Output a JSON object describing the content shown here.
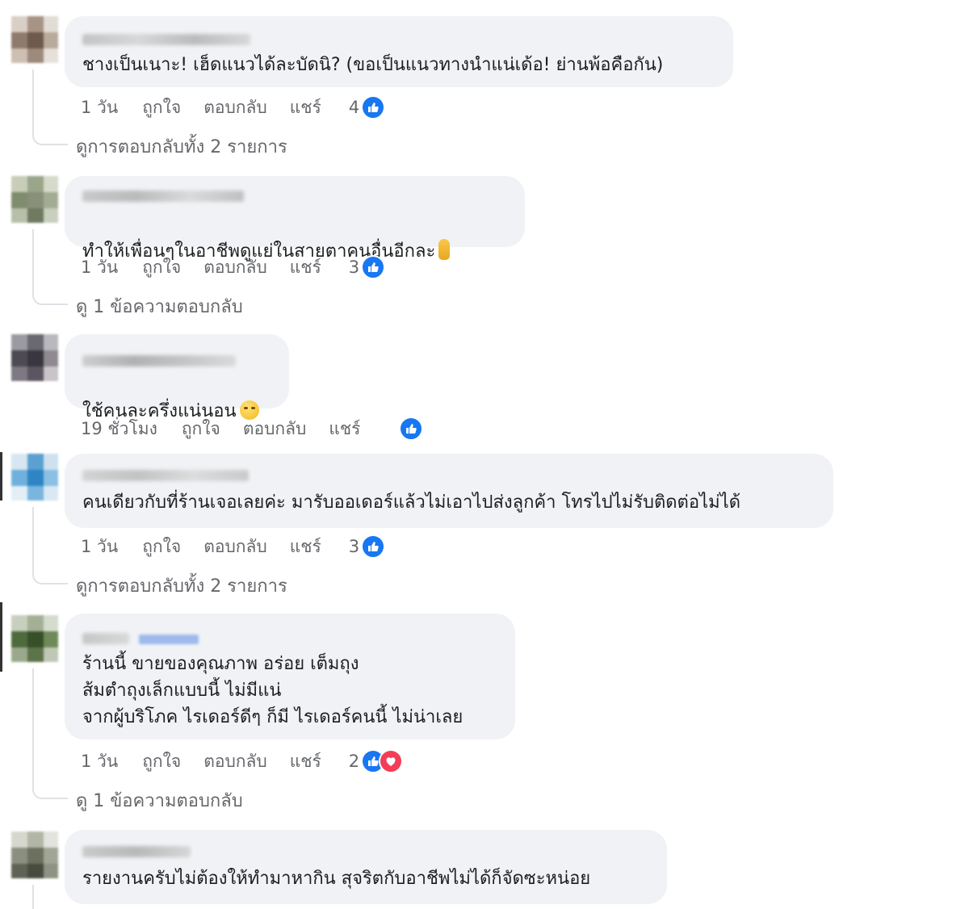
{
  "colors": {
    "bubble_bg": "#f0f2f5",
    "like_blue": "#1877f2",
    "love_red": "#f33e58",
    "meta_gray": "#65676b",
    "thread_line": "#dfe1e5"
  },
  "actions": {
    "like": "ถูกใจ",
    "reply": "ตอบกลับ",
    "share": "แชร์"
  },
  "comments": [
    {
      "text": "ชางเป็นเนาะ! เฮ็ดแนวได้ละบัดนิ? (ขอเป็นแนวทางนำแน่เด้อ! ย่านพ้อคือกัน)",
      "time": "1 วัน",
      "reaction_count": "4",
      "reactions": [
        "like-icon"
      ],
      "replies_link": "ดูการตอบกลับทั้ง 2 รายการ"
    },
    {
      "text": "ทำให้เพื่อนๆในอาชีพดูแย่ในสายตาคนอื่นอีกละ",
      "emoji": "pointing-finger-emoji",
      "time": "1 วัน",
      "reaction_count": "3",
      "reactions": [
        "like-icon"
      ],
      "replies_link": "ดู 1 ข้อความตอบกลับ"
    },
    {
      "text": "ใช้คนละครึ่งแน่นอน",
      "emoji": "face-emoji",
      "time": "19 ชั่วโมง",
      "reaction_count": "",
      "reactions": [
        "like-icon"
      ],
      "replies_link": ""
    },
    {
      "text": "คนเดียวกับที่ร้านเจอเลยค่ะ มารับออเดอร์แล้วไม่เอาไปส่งลูกค้า โทรไปไม่รับติดต่อไม่ได้",
      "time": "1 วัน",
      "reaction_count": "3",
      "reactions": [
        "like-icon"
      ],
      "replies_link": "ดูการตอบกลับทั้ง 2 รายการ"
    },
    {
      "text": "ร้านนี้ ขายของคุณภาพ อร่อย เต็มถุง\nส้มตำถุงเล็กแบบนี้ ไม่มีแน่\nจากผู้บริโภค ไรเดอร์ดีๆ ก็มี ไรเดอร์คนนี้ ไม่น่าเลย",
      "time": "1 วัน",
      "reaction_count": "2",
      "reactions": [
        "like-icon",
        "love-icon"
      ],
      "replies_link": "ดู 1 ข้อความตอบกลับ"
    },
    {
      "text": "รายงานครับไม่ต้องให้ทำมาหากิน สุจริตกับอาชีพไม่ได้ก็จัดซะหน่อย",
      "time": "",
      "reaction_count": "",
      "reactions": [],
      "replies_link": ""
    }
  ]
}
